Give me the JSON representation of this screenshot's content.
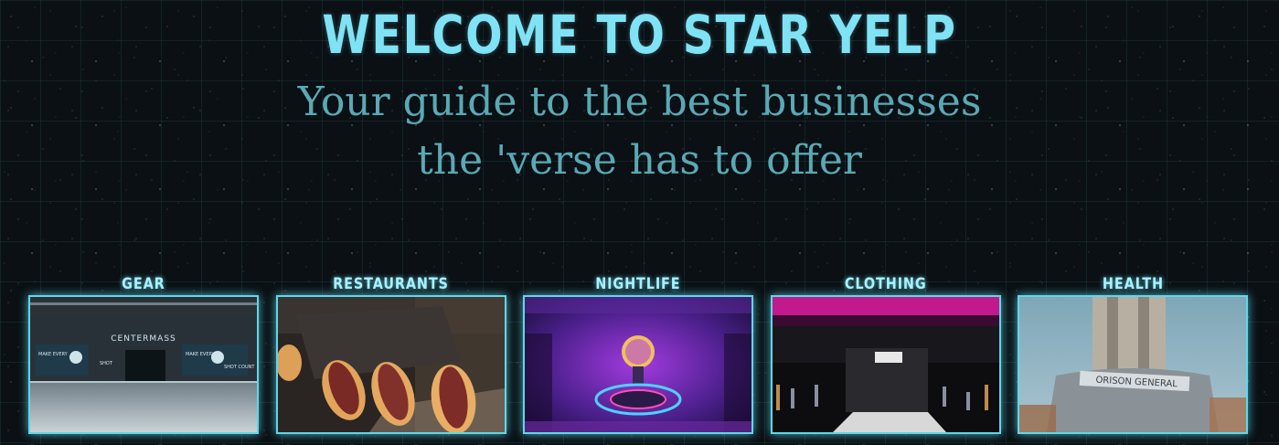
{
  "hero": {
    "title": "WELCOME TO STAR YELP",
    "subtitle_line1": "Your guide to the best businesses",
    "subtitle_line2": "the 'verse has to offer"
  },
  "categories": [
    {
      "label": "GEAR",
      "image_text": "CENTERMASS",
      "sign_left": "MAKE EVERY",
      "sign_mid": "SHOT",
      "sign_right": "MAKE EVERY",
      "sign_right2": "SHOT COUNT"
    },
    {
      "label": "RESTAURANTS"
    },
    {
      "label": "NIGHTLIFE"
    },
    {
      "label": "CLOTHING"
    },
    {
      "label": "HEALTH",
      "image_text": "ORISON GENERAL"
    }
  ],
  "colors": {
    "title": "#7fe3f5",
    "subtitle": "#5aa9b5",
    "card_border": "#5fd7ea",
    "grid": "#3c7882"
  }
}
